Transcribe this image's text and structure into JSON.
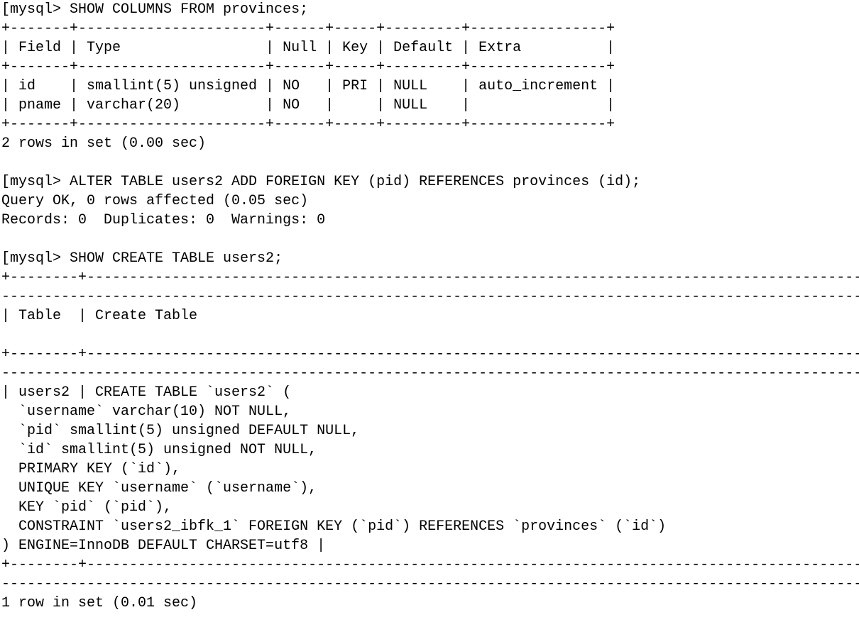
{
  "terminal": {
    "prompt": "[mysql> ",
    "cmd1": "SHOW COLUMNS FROM provinces;",
    "border": "+-------+----------------------+------+-----+---------+----------------+",
    "header": "| Field | Type                 | Null | Key | Default | Extra          |",
    "row1": "| id    | smallint(5) unsigned | NO   | PRI | NULL    | auto_increment |",
    "row2": "| pname | varchar(20)          | NO   |     | NULL    |                |",
    "rowsummary1": "2 rows in set (0.00 sec)",
    "cmd2": "ALTER TABLE users2 ADD FOREIGN KEY (pid) REFERENCES provinces (id);",
    "alter_ok": "Query OK, 0 rows affected (0.05 sec)",
    "alter_detail": "Records: 0  Duplicates: 0  Warnings: 0",
    "cmd3": "SHOW CREATE TABLE users2;",
    "wide_border_top": "+--------+---------------------------------------------------------------------------------------------",
    "wide_border_fill": "-----------------------------------------------------------------------------------------------------",
    "show_header": "| Table  | Create Table",
    "ct_open": "| users2 | CREATE TABLE `users2` (",
    "ct_l1": "  `username` varchar(10) NOT NULL,",
    "ct_l2": "  `pid` smallint(5) unsigned DEFAULT NULL,",
    "ct_l3": "  `id` smallint(5) unsigned NOT NULL,",
    "ct_l4": "  PRIMARY KEY (`id`),",
    "ct_l5": "  UNIQUE KEY `username` (`username`),",
    "ct_l6": "  KEY `pid` (`pid`),",
    "ct_l7": "  CONSTRAINT `users2_ibfk_1` FOREIGN KEY (`pid`) REFERENCES `provinces` (`id`)",
    "ct_close": ") ENGINE=InnoDB DEFAULT CHARSET=utf8 |",
    "rowsummary2": "1 row in set (0.01 sec)"
  }
}
